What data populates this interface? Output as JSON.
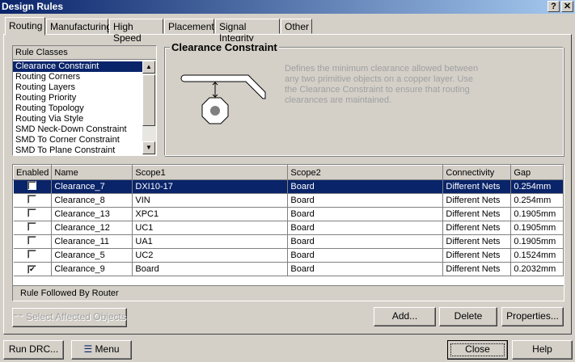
{
  "window": {
    "title": "Design Rules",
    "help_btn": "?",
    "close_btn": "✕"
  },
  "tabs": [
    {
      "label": "Routing"
    },
    {
      "label": "Manufacturing"
    },
    {
      "label": "High Speed"
    },
    {
      "label": "Placement"
    },
    {
      "label": "Signal Integrity"
    },
    {
      "label": "Other"
    }
  ],
  "rule_classes": {
    "header": "Rule Classes",
    "items": [
      "Clearance Constraint",
      "Routing Corners",
      "Routing Layers",
      "Routing Priority",
      "Routing Topology",
      "Routing Via Style",
      "SMD Neck-Down Constraint",
      "SMD To Corner Constraint",
      "SMD To Plane Constraint"
    ],
    "selected": "Clearance Constraint"
  },
  "description": {
    "title": "Clearance Constraint",
    "text": "Defines the minimum clearance allowed between any two primitive objects on a copper layer. Use the Clearance Constraint to ensure that routing clearances are maintained."
  },
  "table": {
    "columns": [
      "Enabled",
      "Name",
      "Scope1",
      "Scope2",
      "Connectivity",
      "Gap"
    ],
    "rows": [
      {
        "enabled": false,
        "name": "Clearance_7",
        "scope1": "DXI10-17",
        "scope2": "Board",
        "connectivity": "Different Nets",
        "gap": "0.254mm",
        "selected": true
      },
      {
        "enabled": false,
        "name": "Clearance_8",
        "scope1": "VIN",
        "scope2": "Board",
        "connectivity": "Different Nets",
        "gap": "0.254mm"
      },
      {
        "enabled": false,
        "name": "Clearance_13",
        "scope1": "XPC1",
        "scope2": "Board",
        "connectivity": "Different Nets",
        "gap": "0.1905mm"
      },
      {
        "enabled": false,
        "name": "Clearance_12",
        "scope1": "UC1",
        "scope2": "Board",
        "connectivity": "Different Nets",
        "gap": "0.1905mm"
      },
      {
        "enabled": false,
        "name": "Clearance_11",
        "scope1": "UA1",
        "scope2": "Board",
        "connectivity": "Different Nets",
        "gap": "0.1905mm"
      },
      {
        "enabled": false,
        "name": "Clearance_5",
        "scope1": "UC2",
        "scope2": "Board",
        "connectivity": "Different Nets",
        "gap": "0.1524mm"
      },
      {
        "enabled": true,
        "name": "Clearance_9",
        "scope1": "Board",
        "scope2": "Board",
        "connectivity": "Different Nets",
        "gap": "0.2032mm"
      }
    ],
    "footer": "Rule Followed By Router"
  },
  "buttons": {
    "select_affected": "Select Affected Objects",
    "add": "Add...",
    "delete": "Delete",
    "properties": "Properties...",
    "run_drc": "Run DRC...",
    "menu": "Menu",
    "close": "Close",
    "help": "Help"
  }
}
